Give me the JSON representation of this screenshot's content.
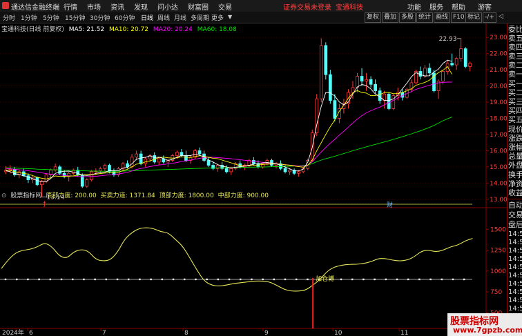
{
  "app": {
    "name": "通达信金融终端",
    "menu": [
      "行情",
      "市场",
      "资讯",
      "发现",
      "问小达",
      "财富圈",
      "交易"
    ],
    "alert": "证券交易未登录",
    "stock_link": "宝通科技",
    "controls": [
      "功能",
      "服务",
      "帮助",
      "游客"
    ]
  },
  "toolbar": {
    "periods": [
      "分时",
      "1分钟",
      "5分钟",
      "15分钟",
      "30分钟",
      "60分钟",
      "日线",
      "周线",
      "月线",
      "多周期",
      "更多"
    ],
    "active_period": "日线",
    "right_buttons": [
      "复权",
      "叠加",
      "多股",
      "统计",
      "画线",
      "F10",
      "标记",
      "-/+"
    ]
  },
  "main_chart": {
    "header": {
      "stock": "宝通科技(日线 前复权)",
      "ma5": "MA5: 21.52",
      "ma10": "MA10: 20.72",
      "ma20": "MA20: 20.24",
      "ma60": "MA60: 18.08"
    },
    "annotations": {
      "high": "22.93",
      "low": "13.14",
      "mark_cai": "财",
      "mark_zhi": "扌"
    }
  },
  "sub_chart": {
    "header": {
      "name": "股票指标网",
      "bottom_force": "底部力度: 200.00",
      "trade_force": "买卖力道: 1371.84",
      "top_force": "顶部力度: 1800.00",
      "mid_force": "中部力度: 900.00"
    },
    "signal_label": "加仓博"
  },
  "right_panel": {
    "items": [
      "委比",
      "卖五",
      "卖四",
      "卖三",
      "卖二",
      "卖一",
      "买一",
      "买二",
      "买三",
      "买四",
      "买五",
      "现价",
      "涨跌",
      "涨幅",
      "总量",
      "外盘",
      "换手",
      "净资",
      "收益"
    ],
    "lower_items": [
      "自动",
      "交易",
      "盘后"
    ],
    "times": [
      "14:5",
      "14:5",
      "14:5",
      "14:5",
      "14:5",
      "14:5",
      "14:5",
      "14:5",
      "14:5",
      "14:5"
    ]
  },
  "watermark": {
    "line1": "股票指标网",
    "line2": "www.7gpzb.com"
  },
  "colors": {
    "up": "#ff3c3c",
    "down": "#54fcfc",
    "ma5": "#ffffff",
    "ma10": "#ffff00",
    "ma20": "#ff00ff",
    "ma60": "#00e000",
    "indicator": "#e8e85a"
  },
  "chart_data": {
    "type": "candlestick",
    "title": "",
    "price_axis": {
      "ticks": [
        23.0,
        22.0,
        21.0,
        20.0,
        19.0,
        18.0,
        17.0,
        16.0,
        15.0,
        14.0,
        13.0
      ],
      "labels": [
        "23.00",
        "22.00",
        "21.00",
        "20.00",
        "19.00",
        "18.00",
        "17.00",
        "16.00",
        "15.00",
        "14.00",
        "13.00"
      ],
      "ylim": [
        12.65,
        23.35
      ]
    },
    "indicator_axis": {
      "ticks": [
        1500,
        1250,
        1000,
        750,
        500
      ],
      "labels": [
        "1500",
        "1250",
        "1000",
        "750",
        "500"
      ],
      "ylim": [
        230,
        1800
      ]
    },
    "x_axis_labels": [
      "2024年",
      "6",
      "7",
      "8",
      "9",
      "10",
      "11"
    ],
    "candles": [
      [
        14.7,
        15.05,
        14.55,
        14.8
      ],
      [
        14.8,
        15.1,
        14.6,
        14.85
      ],
      [
        14.85,
        15.0,
        14.4,
        14.5
      ],
      [
        14.5,
        14.8,
        14.3,
        14.7
      ],
      [
        14.7,
        14.9,
        14.4,
        14.45
      ],
      [
        14.45,
        14.6,
        14.0,
        14.2
      ],
      [
        14.2,
        14.5,
        14.0,
        14.35
      ],
      [
        14.35,
        14.4,
        13.8,
        13.9
      ],
      [
        13.9,
        14.2,
        13.14,
        14.1
      ],
      [
        14.1,
        14.6,
        14.0,
        14.5
      ],
      [
        14.5,
        14.9,
        14.3,
        14.8
      ],
      [
        14.8,
        15.2,
        14.7,
        15.0
      ],
      [
        15.0,
        15.1,
        14.5,
        14.6
      ],
      [
        14.6,
        14.8,
        14.3,
        14.4
      ],
      [
        14.4,
        14.7,
        14.1,
        14.6
      ],
      [
        14.6,
        14.9,
        14.5,
        14.8
      ],
      [
        14.8,
        15.0,
        14.4,
        14.5
      ],
      [
        14.5,
        14.6,
        13.7,
        13.8
      ],
      [
        13.8,
        14.3,
        13.7,
        14.2
      ],
      [
        14.2,
        14.8,
        14.1,
        14.7
      ],
      [
        14.7,
        14.9,
        14.5,
        14.75
      ],
      [
        14.75,
        15.0,
        14.6,
        14.9
      ],
      [
        14.9,
        15.2,
        14.7,
        15.1
      ],
      [
        15.1,
        15.2,
        14.6,
        14.7
      ],
      [
        14.7,
        14.9,
        14.4,
        14.5
      ],
      [
        14.5,
        15.0,
        14.4,
        14.9
      ],
      [
        14.9,
        15.3,
        14.8,
        15.2
      ],
      [
        15.2,
        15.4,
        14.9,
        15.0
      ],
      [
        15.0,
        15.8,
        14.9,
        15.6
      ],
      [
        15.6,
        16.0,
        15.4,
        15.8
      ],
      [
        15.8,
        16.0,
        15.1,
        15.2
      ],
      [
        15.2,
        15.6,
        15.0,
        15.5
      ],
      [
        15.5,
        15.8,
        15.3,
        15.7
      ],
      [
        15.7,
        15.9,
        15.2,
        15.3
      ],
      [
        15.3,
        15.6,
        15.1,
        15.5
      ],
      [
        15.5,
        15.7,
        15.2,
        15.3
      ],
      [
        15.3,
        15.5,
        15.0,
        15.4
      ],
      [
        15.4,
        15.8,
        15.3,
        15.7
      ],
      [
        15.7,
        16.0,
        15.5,
        15.9
      ],
      [
        15.9,
        16.1,
        15.6,
        15.7
      ],
      [
        15.7,
        16.0,
        15.3,
        15.4
      ],
      [
        15.4,
        15.7,
        15.2,
        15.6
      ],
      [
        15.6,
        16.1,
        15.5,
        16.0
      ],
      [
        16.0,
        16.2,
        15.7,
        15.8
      ],
      [
        15.8,
        16.0,
        15.3,
        15.4
      ],
      [
        15.4,
        15.6,
        15.0,
        15.1
      ],
      [
        15.1,
        15.3,
        14.8,
        14.9
      ],
      [
        14.9,
        15.2,
        14.7,
        15.1
      ],
      [
        15.1,
        15.3,
        14.8,
        14.9
      ],
      [
        14.9,
        15.1,
        14.6,
        14.7
      ],
      [
        14.7,
        15.0,
        14.5,
        14.9
      ],
      [
        14.9,
        15.3,
        14.8,
        15.2
      ],
      [
        15.2,
        15.4,
        14.9,
        15.0
      ],
      [
        15.0,
        15.2,
        14.8,
        15.1
      ],
      [
        15.1,
        15.5,
        15.0,
        15.4
      ],
      [
        15.4,
        15.6,
        15.1,
        15.2
      ],
      [
        15.2,
        15.4,
        14.9,
        15.0
      ],
      [
        15.0,
        15.3,
        14.9,
        15.2
      ],
      [
        15.2,
        15.5,
        15.1,
        15.4
      ],
      [
        15.4,
        15.5,
        15.0,
        15.1
      ],
      [
        15.1,
        15.3,
        14.9,
        15.2
      ],
      [
        15.2,
        15.4,
        14.8,
        14.9
      ],
      [
        14.9,
        15.1,
        14.6,
        14.7
      ],
      [
        14.7,
        14.9,
        14.5,
        14.8
      ],
      [
        14.8,
        14.9,
        14.5,
        14.6
      ],
      [
        14.6,
        14.8,
        14.4,
        14.7
      ],
      [
        14.7,
        15.0,
        14.6,
        14.9
      ],
      [
        14.9,
        15.5,
        14.8,
        15.4
      ],
      [
        15.4,
        17.3,
        15.3,
        17.1
      ],
      [
        17.1,
        19.5,
        16.9,
        19.2
      ],
      [
        19.2,
        22.95,
        19.0,
        22.5
      ],
      [
        22.5,
        22.7,
        20.4,
        20.7
      ],
      [
        20.7,
        21.0,
        18.9,
        19.1
      ],
      [
        19.1,
        19.5,
        17.8,
        18.0
      ],
      [
        18.0,
        18.9,
        17.7,
        18.6
      ],
      [
        18.6,
        19.2,
        18.3,
        18.9
      ],
      [
        18.9,
        19.8,
        18.6,
        19.6
      ],
      [
        19.6,
        20.3,
        19.2,
        19.9
      ],
      [
        19.9,
        20.8,
        19.6,
        20.6
      ],
      [
        20.6,
        21.1,
        20.0,
        20.3
      ],
      [
        20.3,
        20.8,
        19.7,
        20.4
      ],
      [
        20.4,
        20.6,
        19.9,
        20.1
      ],
      [
        20.1,
        20.4,
        19.5,
        19.7
      ],
      [
        19.7,
        19.9,
        18.9,
        19.1
      ],
      [
        19.1,
        19.7,
        18.6,
        19.5
      ],
      [
        19.5,
        19.6,
        18.5,
        18.6
      ],
      [
        18.6,
        19.5,
        18.5,
        19.4
      ],
      [
        19.4,
        19.9,
        19.1,
        19.6
      ],
      [
        19.6,
        19.8,
        19.1,
        19.3
      ],
      [
        19.3,
        19.9,
        19.2,
        19.8
      ],
      [
        19.8,
        20.4,
        19.6,
        20.2
      ],
      [
        20.2,
        21.0,
        20.1,
        20.9
      ],
      [
        20.9,
        21.2,
        20.4,
        20.6
      ],
      [
        20.6,
        21.3,
        20.5,
        21.1
      ],
      [
        21.1,
        21.4,
        20.6,
        20.8
      ],
      [
        20.8,
        21.0,
        19.6,
        19.7
      ],
      [
        19.7,
        20.4,
        19.2,
        20.3
      ],
      [
        20.3,
        21.0,
        20.1,
        20.9
      ],
      [
        20.9,
        21.6,
        20.7,
        21.4
      ],
      [
        21.4,
        22.0,
        21.2,
        21.3
      ],
      [
        21.3,
        21.8,
        21.0,
        21.7
      ],
      [
        21.7,
        22.93,
        21.5,
        22.3
      ],
      [
        22.3,
        22.4,
        21.1,
        21.2
      ],
      [
        21.2,
        21.5,
        20.9,
        21.4
      ]
    ],
    "ma5": [
      14.77,
      14.7,
      14.58,
      14.53,
      14.44,
      14.37,
      14.28,
      14.14,
      14.1,
      14.1,
      14.28,
      14.6,
      14.69,
      14.73,
      14.74,
      14.68,
      14.6,
      14.49,
      14.47,
      14.5,
      14.6,
      14.66,
      14.67,
      14.76,
      14.76,
      14.77,
      14.93,
      14.97,
      15.19,
      15.47,
      15.55,
      15.59,
      15.68,
      15.58,
      15.6,
      15.52,
      15.4,
      15.46,
      15.6,
      15.71,
      15.69,
      15.7,
      15.79,
      15.72,
      15.62,
      15.42,
      15.3,
      15.14,
      15.05,
      14.99,
      14.93,
      14.98,
      15.0,
      15.05,
      15.1,
      15.17,
      15.2,
      15.24,
      15.27,
      15.23,
      15.19,
      15.1,
      14.99,
      14.88,
      14.75,
      14.75,
      14.86,
      15.29,
      16.19,
      17.62,
      18.75,
      19.6,
      19.57,
      19.38,
      19.01,
      18.84,
      19.0,
      19.5,
      19.94,
      20.09,
      20.03,
      19.81,
      19.5,
      19.32,
      19.11,
      19.1,
      19.2,
      19.45,
      19.83,
      20.17,
      20.57,
      20.82,
      20.7,
      20.62,
      20.63,
      20.86,
      21.04,
      21.4,
      21.6,
      21.52
    ],
    "ma10": [
      14.8,
      14.78,
      14.7,
      14.64,
      14.6,
      14.55,
      14.46,
      14.36,
      14.3,
      14.25,
      14.33,
      14.44,
      14.41,
      14.42,
      14.43,
      14.44,
      14.49,
      14.51,
      14.52,
      14.53,
      14.55,
      14.59,
      14.62,
      14.63,
      14.64,
      14.66,
      14.77,
      14.85,
      15.01,
      15.17,
      15.2,
      15.31,
      15.37,
      15.47,
      15.58,
      15.6,
      15.56,
      15.54,
      15.56,
      15.62,
      15.6,
      15.58,
      15.64,
      15.69,
      15.65,
      15.59,
      15.53,
      15.51,
      15.42,
      15.33,
      15.25,
      15.16,
      15.08,
      15.06,
      15.07,
      15.09,
      15.12,
      15.15,
      15.17,
      15.18,
      15.18,
      15.17,
      15.13,
      15.1,
      15.06,
      15.01,
      14.98,
      15.09,
      15.42,
      16.0,
      16.5,
      17.0,
      17.48,
      17.9,
      18.44,
      18.8,
      19.25,
      19.57,
      19.72,
      19.6,
      19.56,
      19.4,
      19.41,
      19.47,
      19.59,
      19.6,
      19.52,
      19.53,
      19.59,
      19.7,
      19.83,
      20.04,
      20.13,
      20.22,
      20.36,
      20.6,
      20.83,
      20.97,
      21.2,
      20.72
    ],
    "ma20": [
      14.9,
      14.88,
      14.85,
      14.82,
      14.79,
      14.76,
      14.72,
      14.68,
      14.63,
      14.58,
      14.55,
      14.52,
      14.5,
      14.47,
      14.45,
      14.43,
      14.41,
      14.4,
      14.4,
      14.41,
      14.42,
      14.45,
      14.48,
      14.5,
      14.53,
      14.56,
      14.61,
      14.66,
      14.75,
      14.84,
      14.9,
      14.96,
      15.02,
      15.08,
      15.12,
      15.15,
      15.19,
      15.22,
      15.27,
      15.33,
      15.37,
      15.42,
      15.47,
      15.53,
      15.57,
      15.6,
      15.59,
      15.57,
      15.55,
      15.53,
      15.5,
      15.47,
      15.44,
      15.41,
      15.38,
      15.34,
      15.31,
      15.28,
      15.25,
      15.23,
      15.2,
      15.17,
      15.14,
      15.11,
      15.08,
      15.05,
      15.05,
      15.12,
      15.31,
      15.63,
      15.92,
      16.2,
      16.46,
      16.7,
      16.97,
      17.2,
      17.46,
      17.72,
      17.95,
      18.16,
      18.34,
      18.47,
      18.59,
      18.69,
      18.84,
      18.97,
      19.11,
      19.26,
      19.4,
      19.53,
      19.66,
      19.79,
      19.87,
      19.96,
      20.04,
      20.13,
      20.19,
      20.22,
      20.24,
      20.24
    ],
    "ma60": [
      14.95,
      14.94,
      14.93,
      14.91,
      14.9,
      14.89,
      14.88,
      14.86,
      14.85,
      14.84,
      14.83,
      14.82,
      14.81,
      14.8,
      14.79,
      14.78,
      14.77,
      14.76,
      14.75,
      14.74,
      14.74,
      14.73,
      14.73,
      14.73,
      14.73,
      14.73,
      14.74,
      14.75,
      14.76,
      14.77,
      14.78,
      14.79,
      14.8,
      14.81,
      14.82,
      14.83,
      14.84,
      14.85,
      14.86,
      14.87,
      14.88,
      14.89,
      14.9,
      14.91,
      14.92,
      14.93,
      14.93,
      14.94,
      14.94,
      14.95,
      14.95,
      14.96,
      14.97,
      14.97,
      14.98,
      14.98,
      14.99,
      14.99,
      15.0,
      15.01,
      15.02,
      15.02,
      15.03,
      15.04,
      15.05,
      15.06,
      15.08,
      15.12,
      15.2,
      15.32,
      15.42,
      15.5,
      15.58,
      15.66,
      15.74,
      15.82,
      15.91,
      16.0,
      16.08,
      16.16,
      16.24,
      16.32,
      16.39,
      16.47,
      16.54,
      16.62,
      16.7,
      16.78,
      16.86,
      16.95,
      17.04,
      17.14,
      17.23,
      17.33,
      17.44,
      17.56,
      17.7,
      17.85,
      17.97,
      18.08
    ],
    "indicator": [
      1030,
      1140,
      1220,
      1250,
      1260,
      1290,
      1340,
      1290,
      1180,
      1150,
      1230,
      1260,
      1240,
      1140,
      1120,
      1130,
      1220,
      1380,
      1460,
      1510,
      1520,
      1510,
      1470,
      1460,
      1380,
      1300,
      1160,
      1010,
      880,
      830,
      820,
      830,
      850,
      860,
      870,
      880,
      880,
      870,
      830,
      780,
      760,
      760,
      770,
      830,
      900,
      1000,
      1050,
      1070,
      1080,
      1080,
      1090,
      1110,
      1150,
      1150,
      1130,
      1120,
      1130,
      1170,
      1240,
      1250,
      1230,
      1250,
      1290,
      1310,
      1360,
      1390
    ],
    "signal_indices": [
      43
    ],
    "horizontal_levels": {
      "top": 1800,
      "mid": 900,
      "bottom": 200
    }
  }
}
